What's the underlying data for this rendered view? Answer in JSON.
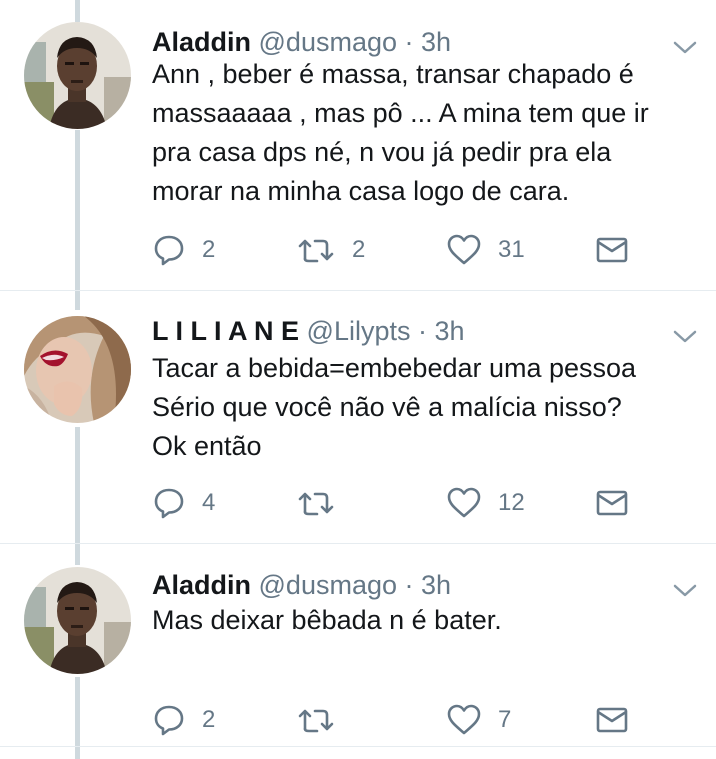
{
  "colors": {
    "text": "#14171a",
    "muted": "#657786",
    "thread_line": "#cfd9de",
    "divider": "#e6ecf0"
  },
  "tweets": [
    {
      "name": "Aladdin",
      "handle": "@dusmago",
      "separator": "·",
      "time": "3h",
      "text": "Ann , beber é massa, transar chapado é\nmassaaaaa , mas pô ... A mina tem que ir\npra casa dps né, n vou já pedir pra ela\nmorar na minha casa logo de cara.",
      "avatar_icon": "man-portrait-avatar",
      "replies": "2",
      "retweets": "2",
      "likes": "31"
    },
    {
      "name": "L I L I A N E",
      "handle": "@Lilypts",
      "separator": "·",
      "time": "3h",
      "text": "Tacar a bebida=embebedar uma pessoa\nSério que você não vê a malícia nisso?\nOk então",
      "avatar_icon": "woman-lips-avatar",
      "replies": "4",
      "retweets": "",
      "likes": "12"
    },
    {
      "name": "Aladdin",
      "handle": "@dusmago",
      "separator": "·",
      "time": "3h",
      "text": "Mas deixar bêbada n é bater.",
      "avatar_icon": "man-portrait-avatar",
      "replies": "2",
      "retweets": "",
      "likes": "7"
    }
  ]
}
